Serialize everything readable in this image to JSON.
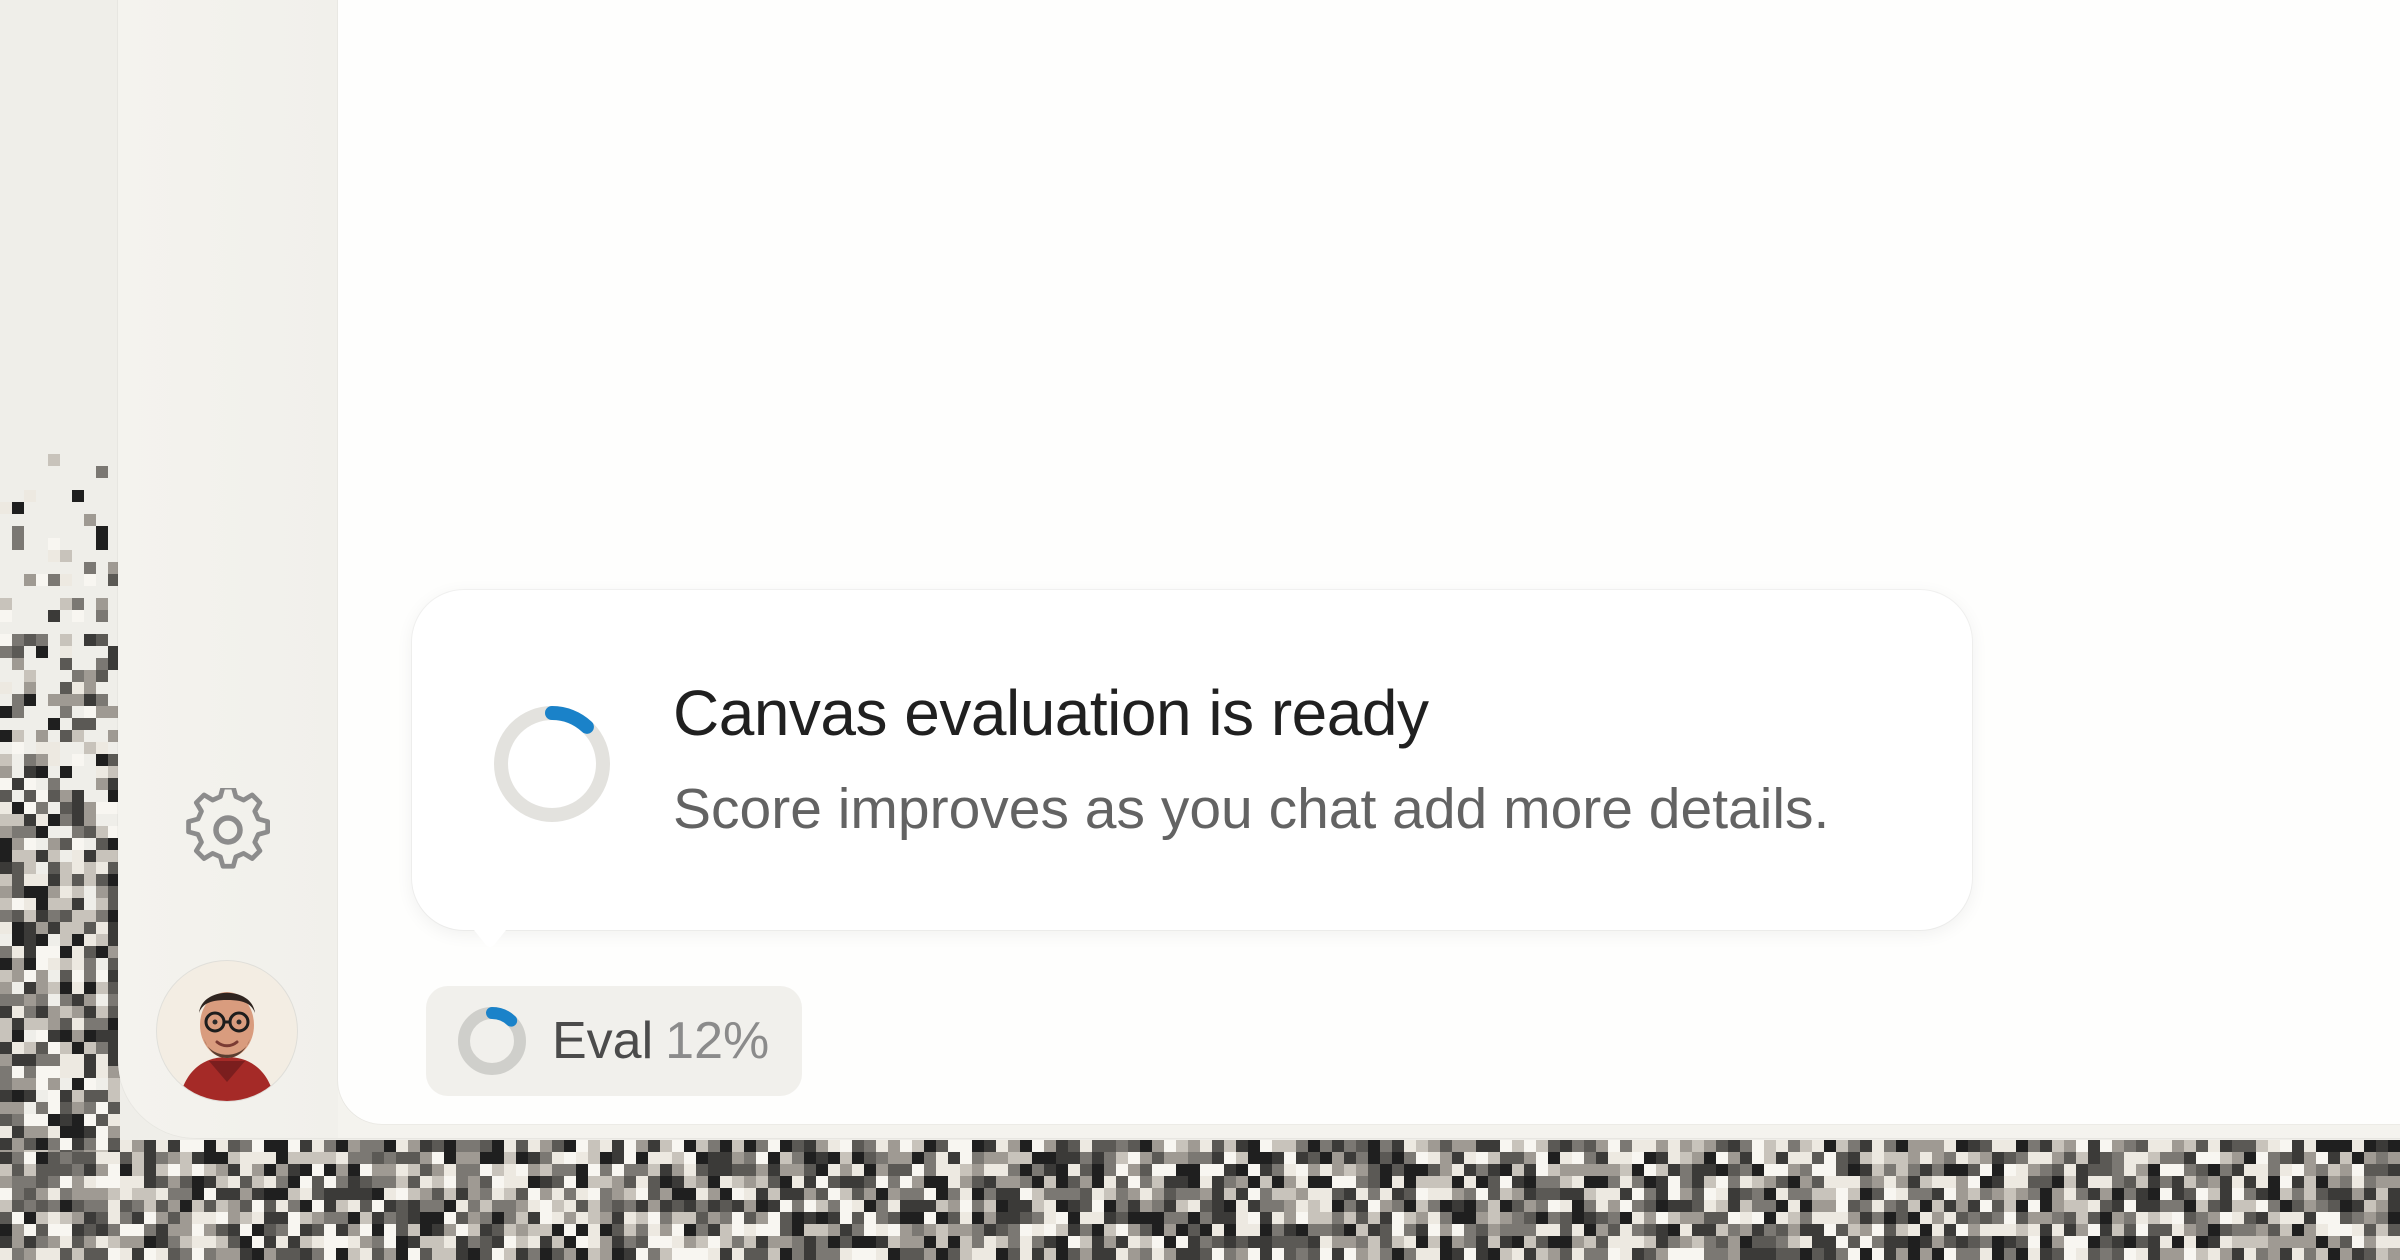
{
  "tooltip": {
    "title": "Canvas evaluation is ready",
    "subtitle": "Score improves as you chat add more details."
  },
  "eval_chip": {
    "label": "Eval",
    "percent_text": "12%",
    "progress_fraction": 0.12
  },
  "icons": {
    "settings": "gear-icon",
    "status": "progress-ring-icon",
    "eval": "progress-ring-icon"
  },
  "colors": {
    "accent": "#1a82c9",
    "ring_track": "#e3e2de",
    "chip_bg": "#f1f0ec"
  }
}
